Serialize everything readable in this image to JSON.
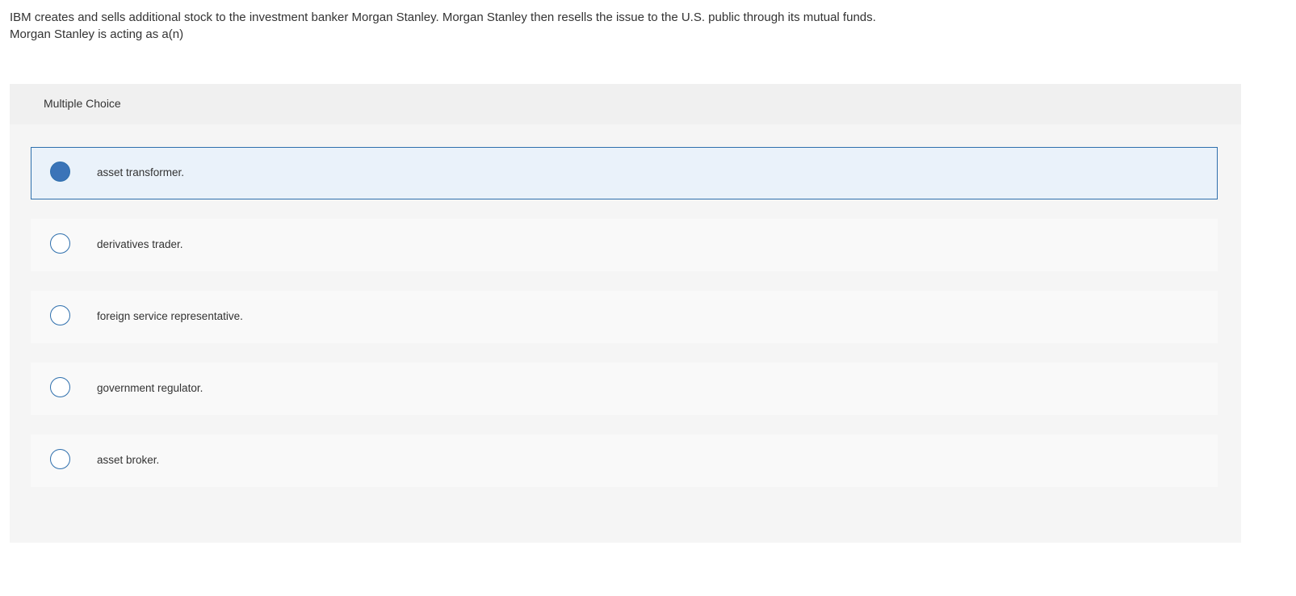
{
  "question": {
    "line1": "IBM creates and sells additional stock to the investment banker Morgan Stanley. Morgan Stanley then resells the issue to the U.S. public through its mutual funds.",
    "line2": "Morgan Stanley is acting as a(n)"
  },
  "panel": {
    "header_label": "Multiple Choice"
  },
  "choices": [
    {
      "label": "asset transformer.",
      "selected": true
    },
    {
      "label": "derivatives trader.",
      "selected": false
    },
    {
      "label": "foreign service representative.",
      "selected": false
    },
    {
      "label": "government regulator.",
      "selected": false
    },
    {
      "label": "asset broker.",
      "selected": false
    }
  ],
  "colors": {
    "accent": "#2e6fad",
    "selected_fill": "#3b74b8",
    "selected_bg": "#eaf2fa",
    "panel_bg": "#f5f5f5"
  }
}
